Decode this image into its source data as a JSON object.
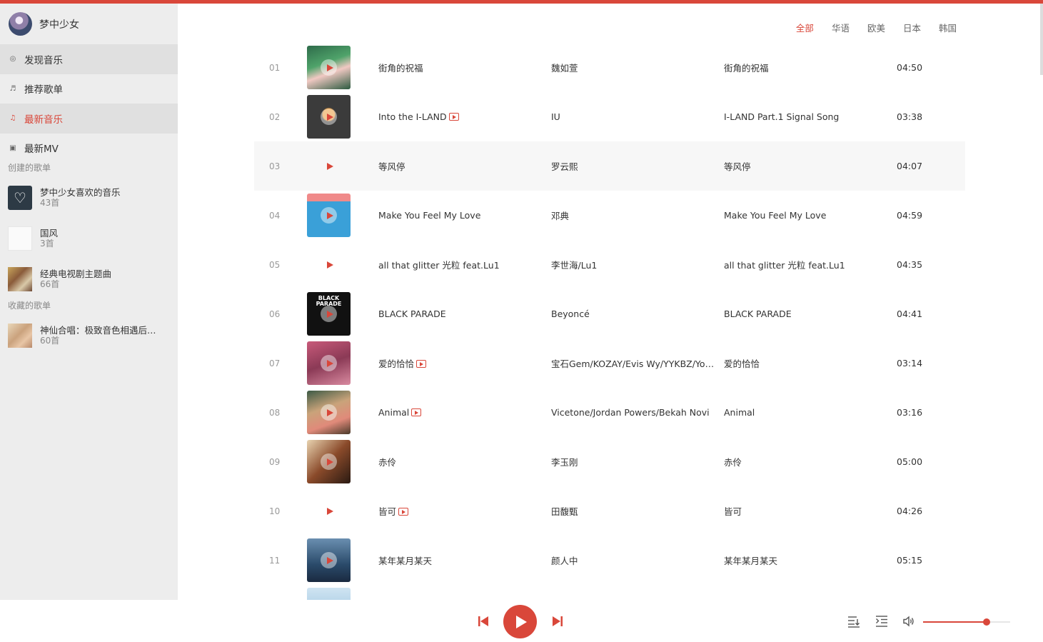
{
  "user": {
    "name": "梦中少女"
  },
  "nav": [
    {
      "icon": "discover-icon",
      "glyph": "◎",
      "label": "发现音乐"
    },
    {
      "icon": "playlist-icon",
      "glyph": "♬",
      "label": "推荐歌单"
    },
    {
      "icon": "music-note-icon",
      "glyph": "♫",
      "label": "最新音乐"
    },
    {
      "icon": "mv-icon",
      "glyph": "▣",
      "label": "最新MV"
    }
  ],
  "created_section": "创建的歌单",
  "created_playlists": [
    {
      "name": "梦中少女喜欢的音乐",
      "count": "43首"
    },
    {
      "name": "国风",
      "count": "3首"
    },
    {
      "name": "经典电视剧主题曲",
      "count": "66首"
    }
  ],
  "collected_section": "收藏的歌单",
  "collected_playlists": [
    {
      "name": "神仙合唱：极致音色相遇后的...",
      "count": "60首"
    }
  ],
  "filters": [
    "全部",
    "华语",
    "欧美",
    "日本",
    "韩国"
  ],
  "active_filter": "全部",
  "songs": [
    {
      "idx": "01",
      "name": "街角的祝福",
      "mv": false,
      "artist": "魏如萱",
      "album": "街角的祝福",
      "duration": "04:50"
    },
    {
      "idx": "02",
      "name": "Into the I-LAND",
      "mv": true,
      "artist": "IU",
      "album": "I-LAND Part.1 Signal Song",
      "duration": "03:38"
    },
    {
      "idx": "03",
      "name": "等风停",
      "mv": false,
      "artist": "罗云熙",
      "album": "等风停",
      "duration": "04:07"
    },
    {
      "idx": "04",
      "name": "Make You Feel My Love",
      "mv": false,
      "artist": "邓典",
      "album": "Make You Feel My Love",
      "duration": "04:59"
    },
    {
      "idx": "05",
      "name": "all that glitter 光粒 feat.Lu1",
      "mv": false,
      "artist": "李世海/Lu1",
      "album": "all that glitter 光粒 feat.Lu1",
      "duration": "04:35"
    },
    {
      "idx": "06",
      "name": "BLACK PARADE",
      "mv": false,
      "artist": "Beyoncé",
      "album": "BLACK PARADE",
      "duration": "04:41"
    },
    {
      "idx": "07",
      "name": "爱的恰恰",
      "mv": true,
      "artist": "宝石Gem/KOZAY/Evis Wy/YYKBZ/Yok...",
      "album": "爱的恰恰",
      "duration": "03:14"
    },
    {
      "idx": "08",
      "name": "Animal",
      "mv": true,
      "artist": "Vicetone/Jordan Powers/Bekah Novi",
      "album": "Animal",
      "duration": "03:16"
    },
    {
      "idx": "09",
      "name": "赤伶",
      "mv": false,
      "artist": "李玉刚",
      "album": "赤伶",
      "duration": "05:00"
    },
    {
      "idx": "10",
      "name": "皆可",
      "mv": true,
      "artist": "田馥甄",
      "album": "皆可",
      "duration": "04:26"
    },
    {
      "idx": "11",
      "name": "某年某月某天",
      "mv": false,
      "artist": "颜人中",
      "album": "某年某月某天",
      "duration": "05:15"
    }
  ],
  "cover_text": {
    "black_parade": "BLACK PARADE"
  },
  "volume": 0.73,
  "accent_color": "#d9473a"
}
